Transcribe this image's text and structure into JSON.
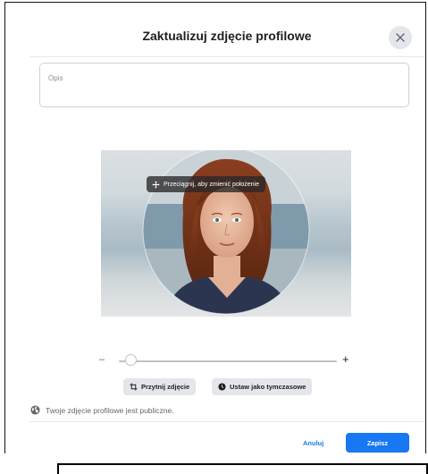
{
  "dialog": {
    "title": "Zaktualizuj zdjęcie profilowe",
    "close_icon": "close-icon"
  },
  "description": {
    "placeholder": "Opis",
    "value": ""
  },
  "photo": {
    "drag_hint": "Przeciągnij, aby zmienić położenie",
    "drag_icon": "move-icon"
  },
  "zoom": {
    "minus_label": "–",
    "plus_label": "+",
    "level": 0.03
  },
  "actions": {
    "crop_label": "Przytnij zdjęcie",
    "crop_icon": "crop-icon",
    "temporary_label": "Ustaw jako tymczasowe",
    "temporary_icon": "clock-icon"
  },
  "privacy": {
    "note": "Twoje zdjęcie profilowe jest publiczne.",
    "icon": "globe-icon"
  },
  "footer": {
    "cancel_label": "Anuluj",
    "save_label": "Zapisz"
  },
  "colors": {
    "primary": "#1877f2",
    "button_gray": "#e4e6eb",
    "text": "#1c1e21",
    "secondary_text": "#65676b"
  }
}
